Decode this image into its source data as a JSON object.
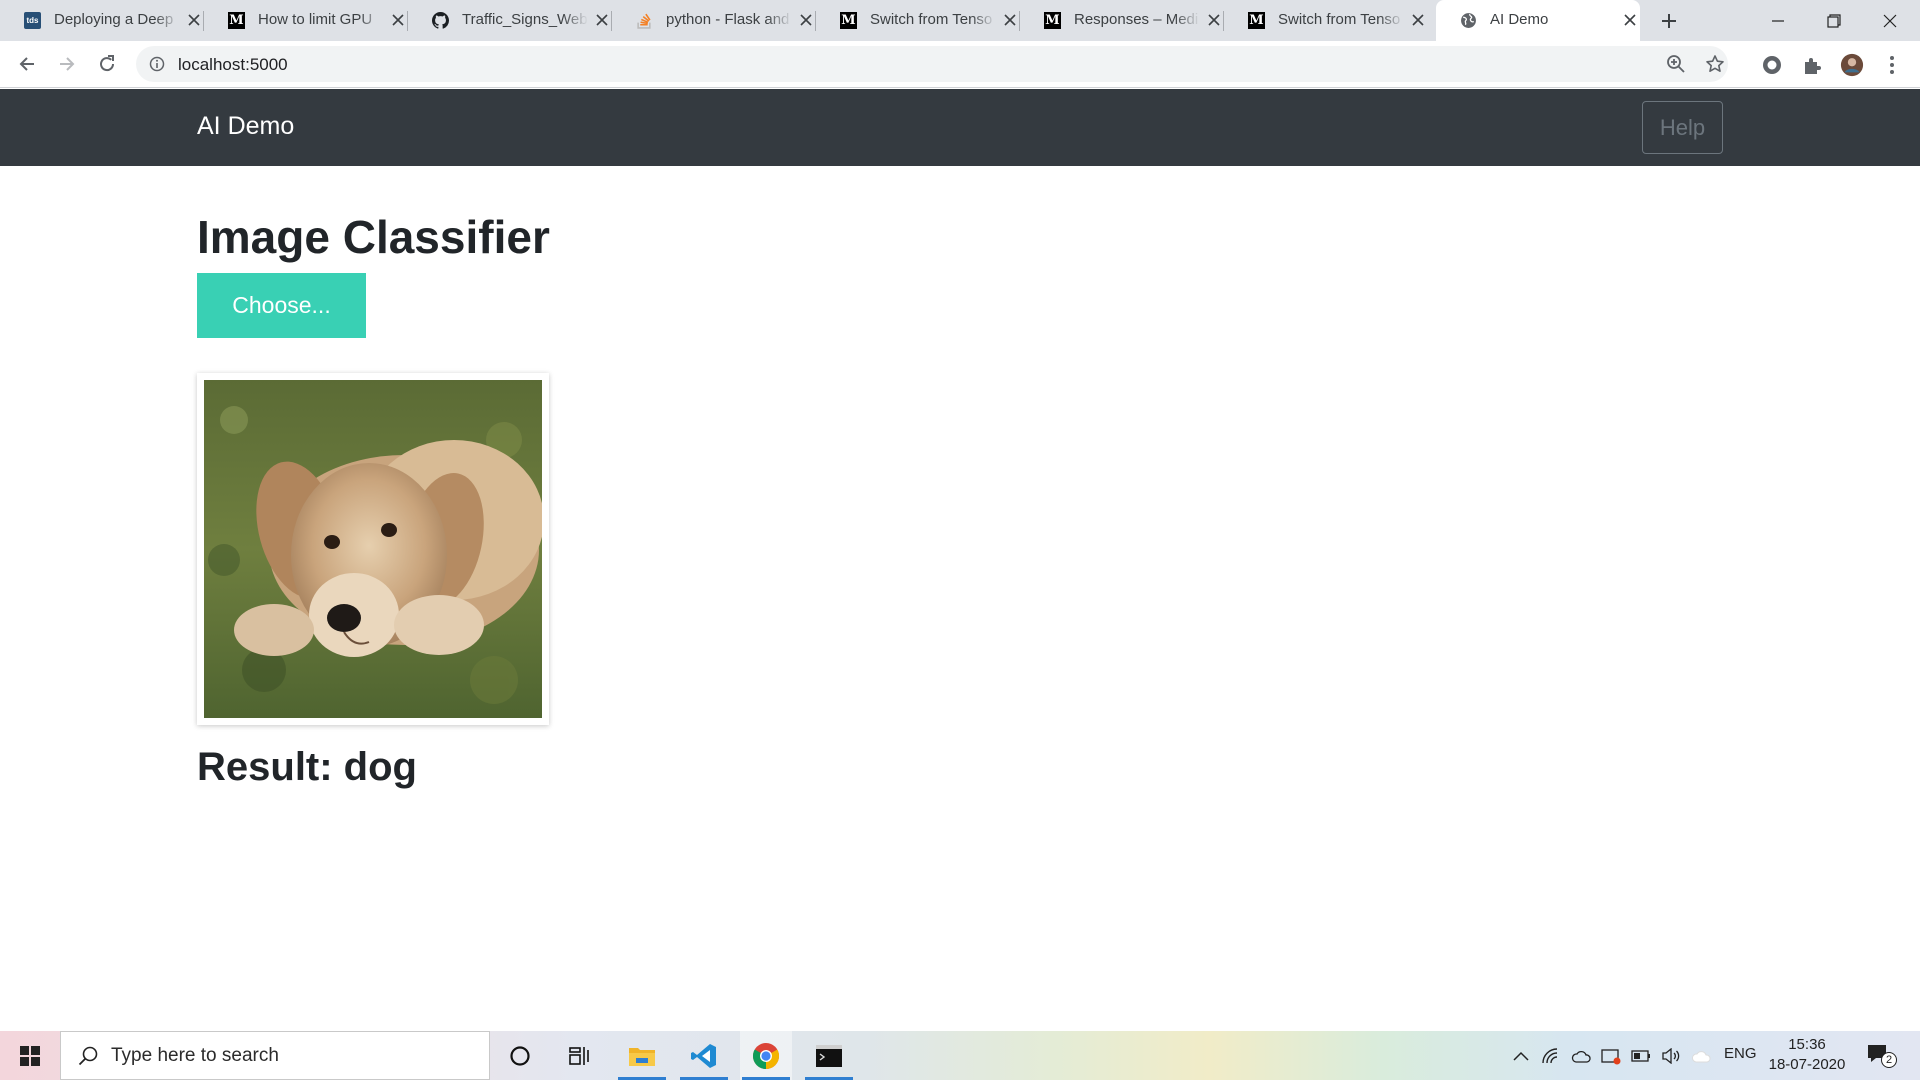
{
  "browser": {
    "tabs": [
      {
        "title": "Deploying a Deep",
        "favicon": "tds-favicon",
        "active": false
      },
      {
        "title": "How to limit GPU",
        "favicon": "medium-favicon",
        "active": false
      },
      {
        "title": "Traffic_Signs_Web",
        "favicon": "github-favicon",
        "active": false
      },
      {
        "title": "python - Flask and",
        "favicon": "stackoverflow-favicon",
        "active": false
      },
      {
        "title": "Switch from Tenso",
        "favicon": "medium-favicon",
        "active": false
      },
      {
        "title": "Responses – Medi",
        "favicon": "medium-favicon",
        "active": false
      },
      {
        "title": "Switch from Tenso",
        "favicon": "medium-favicon",
        "active": false
      },
      {
        "title": "AI Demo",
        "favicon": "globe-favicon",
        "active": true
      }
    ],
    "url": "localhost:5000",
    "favicon_text_tds": "tds",
    "favicon_text_medium": "M"
  },
  "app": {
    "brand": "AI Demo",
    "help_label": "Help",
    "page_title": "Image Classifier",
    "choose_label": "Choose...",
    "result_text": "Result: dog",
    "accent_color": "#39d0b4",
    "navbar_color": "#343a40"
  },
  "taskbar": {
    "search_placeholder": "Type here to search",
    "language": "ENG",
    "time": "15:36",
    "date": "18-07-2020",
    "notification_count": "2"
  }
}
